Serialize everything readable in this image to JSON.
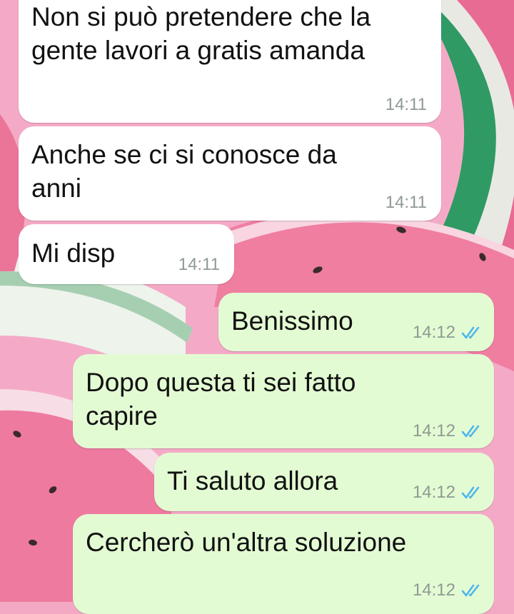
{
  "chat": {
    "messages": [
      {
        "direction": "incoming",
        "text": "Non si può pretendere che la\ngente lavori a gratis amanda",
        "time": "14:11"
      },
      {
        "direction": "incoming",
        "text": "Anche se ci si conosce da\nanni",
        "time": "14:11"
      },
      {
        "direction": "incoming",
        "text": "Mi disp",
        "time": "14:11"
      },
      {
        "direction": "outgoing",
        "text": "Benissimo",
        "time": "14:12",
        "status": "read-double-check-icon"
      },
      {
        "direction": "outgoing",
        "text": "Dopo questa ti sei fatto\ncapire",
        "time": "14:12",
        "status": "read-double-check-icon"
      },
      {
        "direction": "outgoing",
        "text": "Ti saluto allora",
        "time": "14:12",
        "status": "read-double-check-icon"
      },
      {
        "direction": "outgoing",
        "text": "Cercherò un'altra soluzione",
        "time": "14:12",
        "status": "read-double-check-icon"
      }
    ]
  },
  "colors": {
    "incoming_bubble": "#ffffff",
    "outgoing_bubble": "#e3fbd3",
    "timestamp": "#8e9a92",
    "read_ticks": "#4fb6ec",
    "wallpaper_pink": "#f3a9c4",
    "wallpaper_rind": "#2f9a63"
  },
  "wallpaper": {
    "theme": "watermelon-slices"
  }
}
